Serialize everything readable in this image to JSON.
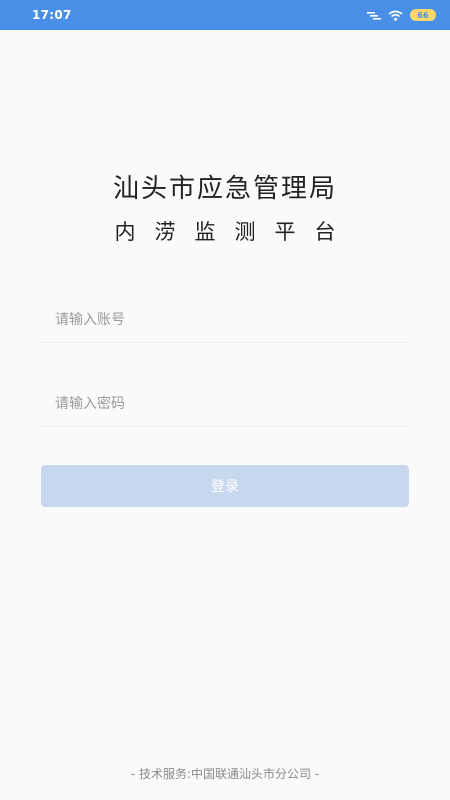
{
  "status_bar": {
    "time": "17:07",
    "icons": [
      "signal-icon",
      "wifi-icon",
      "battery-icon"
    ],
    "battery_text": "66",
    "background_color": "#4a8fe7"
  },
  "header": {
    "title": "汕头市应急管理局",
    "subtitle": "内涝监测平台"
  },
  "form": {
    "account_placeholder": "请输入账号",
    "password_placeholder": "请输入密码",
    "login_label": "登录",
    "login_button_color": "#c7d7ee"
  },
  "footer": {
    "text": "- 技术服务:中国联通汕头市分公司 -"
  }
}
